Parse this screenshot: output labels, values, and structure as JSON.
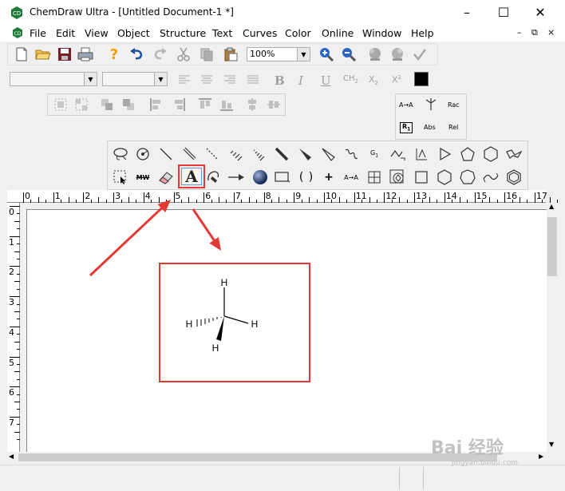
{
  "window": {
    "title": "ChemDraw Ultra - [Untitled Document-1 *]",
    "app_icon": "chemdraw-cd-icon",
    "controls": [
      "minimize-icon",
      "maximize-icon",
      "close-icon"
    ]
  },
  "menubar": {
    "items": [
      "File",
      "Edit",
      "View",
      "Object",
      "Structure",
      "Text",
      "Curves",
      "Color",
      "Online",
      "Window",
      "Help"
    ],
    "mdi_controls": [
      "–",
      "⧉",
      "×"
    ]
  },
  "toolbar": {
    "zoom_value": "100%",
    "icons": [
      "new-document-icon",
      "open-folder-icon",
      "save-icon",
      "print-icon",
      "help-icon",
      "undo-icon",
      "redo-icon",
      "cut-icon",
      "copy-icon",
      "paste-icon",
      "zoom-in-icon",
      "zoom-out-icon",
      "render-icon",
      "render-alt-icon",
      "check-icon"
    ]
  },
  "format_bar": {
    "font_value": "",
    "size_value": "",
    "labels": {
      "bold": "B",
      "italic": "I",
      "underline": "U",
      "formula": "CH",
      "formula_sub": "2",
      "subscript": "X",
      "subscript_sub": "2",
      "superscript": "X",
      "superscript_sup": "2"
    },
    "color": "#000000"
  },
  "stereo_panel": {
    "labels": {
      "a_to_a": "A→A",
      "rac": "Rac",
      "r1": "R",
      "r1_sub": "1",
      "abs": "Abs",
      "rel": "Rel"
    }
  },
  "tools_palette": {
    "selected_tool": "text-tool",
    "highlight_color": "#e53935",
    "labels": {
      "text_tool": "A",
      "mw": "MW",
      "a_to_a": "A→A",
      "plus": "+",
      "brackets": "( )",
      "g_label": "G",
      "g_sub": "1"
    }
  },
  "ruler": {
    "horizontal": [
      "0",
      "1",
      "2",
      "3",
      "4",
      "5",
      "6",
      "7",
      "8",
      "9",
      "10",
      "11",
      "12",
      "13",
      "14",
      "15",
      "16",
      "17"
    ],
    "vertical": [
      "0",
      "1",
      "2",
      "3",
      "4",
      "5",
      "6",
      "7"
    ]
  },
  "molecule": {
    "atoms": {
      "top": "H",
      "left": "H",
      "right": "H",
      "bottom": "H"
    }
  },
  "annotation": {
    "color": "#e53935"
  },
  "watermark": {
    "text": "Bai 经验",
    "sub": "jingyan.baidu.com"
  }
}
